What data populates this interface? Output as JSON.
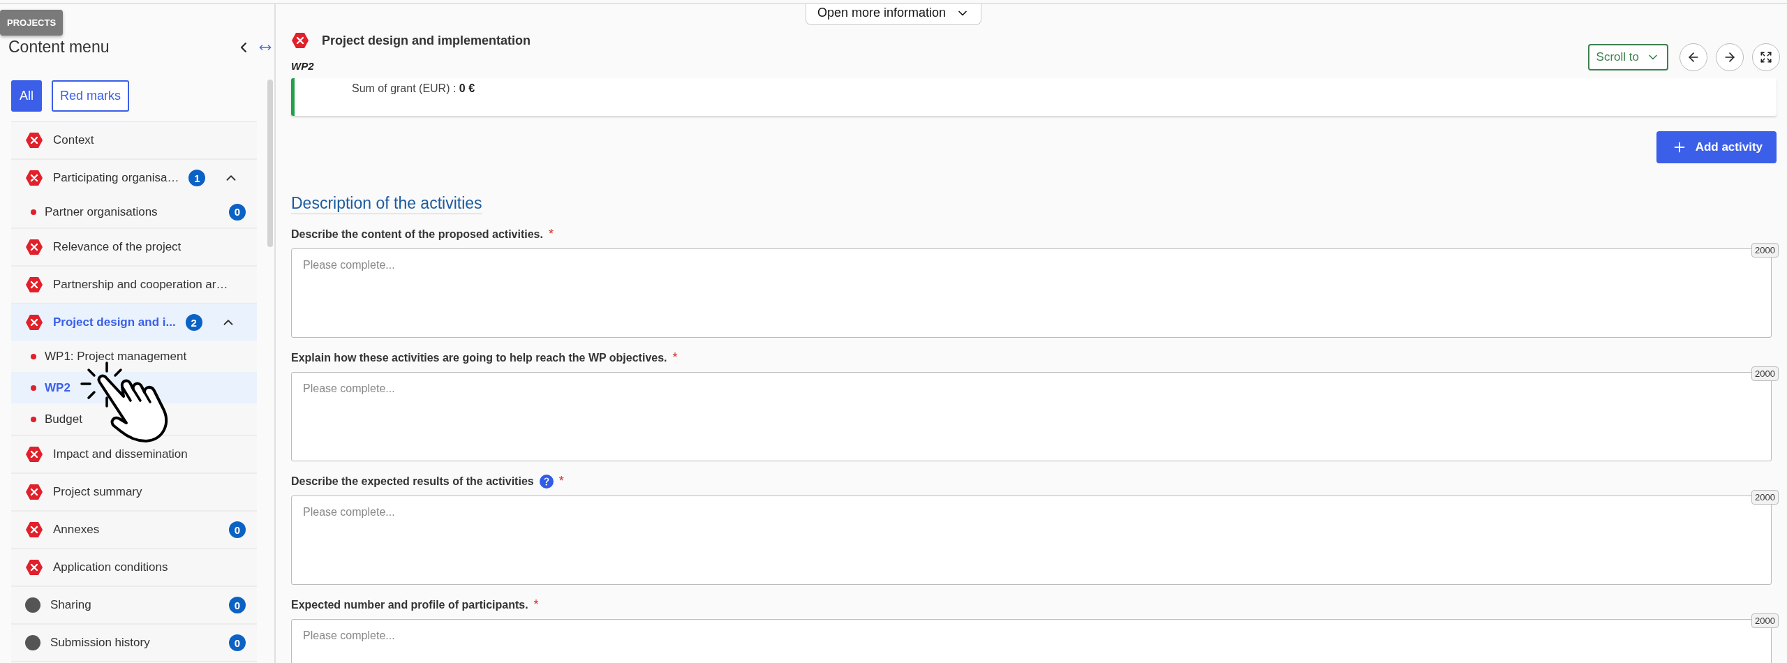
{
  "app_tag": "PROJECTS",
  "info_tab": {
    "label": "Open more information"
  },
  "sidebar": {
    "title": "Content menu",
    "filters": [
      {
        "label": "All",
        "selected": true
      },
      {
        "label": "Red marks",
        "selected": false
      }
    ],
    "items": [
      {
        "label": "Context",
        "kind": "error",
        "selected": false
      },
      {
        "label": "Participating organisa…",
        "kind": "error",
        "selected": false,
        "count": "1",
        "expanded": true,
        "children": [
          {
            "label": "Partner organisations",
            "selected": false,
            "count": "0"
          }
        ]
      },
      {
        "label": "Relevance of the project",
        "kind": "error",
        "selected": false
      },
      {
        "label": "Partnership and cooperation ar…",
        "kind": "error",
        "selected": false
      },
      {
        "label": "Project design and i...",
        "kind": "error",
        "selected": true,
        "count": "2",
        "expanded": true,
        "children": [
          {
            "label": "WP1: Project management",
            "selected": false
          },
          {
            "label": "WP2",
            "selected": true
          },
          {
            "label": "Budget",
            "selected": false
          }
        ]
      },
      {
        "label": "Impact and dissemination",
        "kind": "error",
        "selected": false
      },
      {
        "label": "Project summary",
        "kind": "error",
        "selected": false
      },
      {
        "label": "Annexes",
        "kind": "error",
        "selected": false,
        "count": "0"
      },
      {
        "label": "Application conditions",
        "kind": "error",
        "selected": false
      },
      {
        "label": "Sharing",
        "kind": "neutral",
        "selected": false,
        "count": "0"
      },
      {
        "label": "Submission history",
        "kind": "neutral",
        "selected": false,
        "count": "0"
      }
    ]
  },
  "header": {
    "title": "Project design and implementation",
    "kind": "error",
    "subtitle": "WP2",
    "scroll_to": "Scroll to"
  },
  "summary": {
    "text": "Sum of grant (EUR) : **0 €**"
  },
  "add_button": "Add activity",
  "section_title": "Description of the activities",
  "fields": [
    {
      "label": "Describe the content of the proposed activities.",
      "help": false,
      "required_mark": "*",
      "placeholder": "Please complete...",
      "counter": "2000"
    },
    {
      "label": "Explain how these activities are going to help reach the WP objectives.",
      "help": false,
      "required_mark": "*",
      "placeholder": "Please complete...",
      "counter": "2000"
    },
    {
      "label": "Describe the expected results of the activities",
      "help": true,
      "required_mark": "*",
      "placeholder": "Please complete...",
      "counter": "2000"
    },
    {
      "label": "Expected number and profile of participants.",
      "help": false,
      "required_mark": "*",
      "placeholder": "Please complete...",
      "counter": "2000"
    }
  ]
}
